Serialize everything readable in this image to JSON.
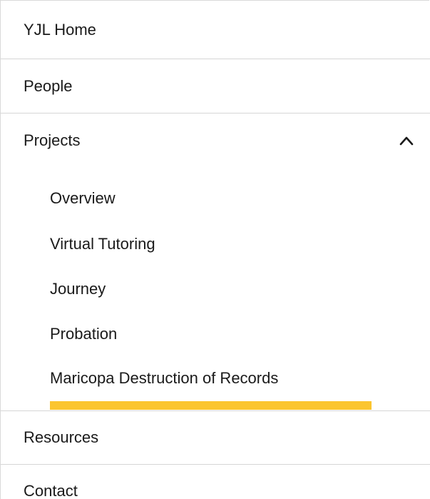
{
  "nav": {
    "items": [
      {
        "label": "YJL Home"
      },
      {
        "label": "People"
      },
      {
        "label": "Projects",
        "expanded": true,
        "toggle_icon": "chevron-up-icon",
        "children": [
          {
            "label": "Overview"
          },
          {
            "label": "Virtual Tutoring"
          },
          {
            "label": "Journey"
          },
          {
            "label": "Probation"
          },
          {
            "label": "Maricopa Destruction of Records",
            "active": true
          }
        ]
      },
      {
        "label": "Resources"
      },
      {
        "label": "Contact"
      }
    ],
    "colors": {
      "active_indicator": "#fbc52f",
      "divider": "#d6d6d6",
      "text": "#1a1a1a"
    }
  }
}
